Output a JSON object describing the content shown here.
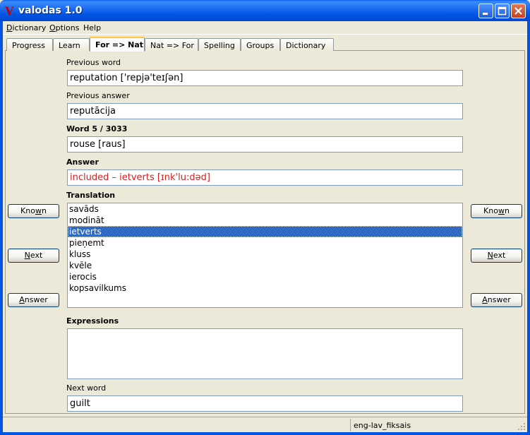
{
  "window": {
    "title": "valodas 1.0",
    "icon_letter": "V"
  },
  "menu": [
    {
      "label_ul": "D",
      "label_rest": "ictionary"
    },
    {
      "label_ul": "O",
      "label_rest": "ptions"
    },
    {
      "label_ul": "",
      "label_rest": "Help"
    }
  ],
  "tabs": [
    "Progress",
    "Learn",
    "For => Nat",
    "Nat => For",
    "Spelling",
    "Groups",
    "Dictionary"
  ],
  "fields": {
    "previous_word_label": "Previous word",
    "previous_word": "reputation ['repjə'teɪʃən]",
    "previous_answer_label": "Previous answer",
    "previous_answer": "reputācija",
    "word_label": "Word 5 / 3033",
    "word": "rouse [raus]",
    "answer_label": "Answer",
    "answer": "included – ietverts [ɪnk'lu:dəd]",
    "translation_label": "Translation",
    "expressions_label": "Expressions",
    "next_word_label": "Next word",
    "next_word": "guilt"
  },
  "translation_options": [
    "savāds",
    "modināt",
    "ietverts",
    "pieņemt",
    "kluss",
    "kvēle",
    "ierocis",
    "kopsavilkums"
  ],
  "selected_index": 2,
  "buttons": {
    "known_pre": "Kno",
    "known_mn": "w",
    "known_post": "n",
    "next_pre": "",
    "next_mn": "N",
    "next_post": "ext",
    "answer_pre": "",
    "answer_mn": "A",
    "answer_post": "nswer"
  },
  "status": {
    "dictionary": "eng-lav_fiksais"
  }
}
